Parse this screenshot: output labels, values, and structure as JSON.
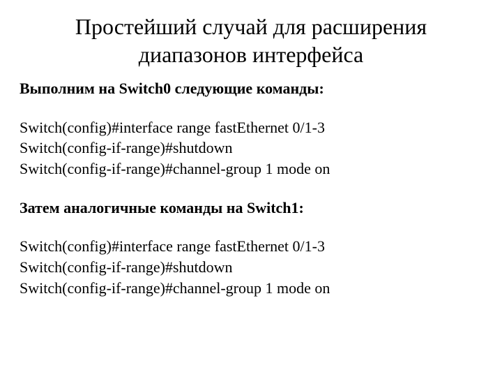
{
  "title_line1": "Простейший случай для расширения",
  "title_line2": "диапазонов интерфейса",
  "section1_heading": "Выполним на Switch0 следующие команды:",
  "section1_cmds": [
    "Switch(config)#interface range fastEthernet 0/1-3",
    "Switch(config-if-range)#shutdown",
    "Switch(config-if-range)#channel-group 1 mode on"
  ],
  "section2_heading": "Затем  аналогичные команды на Switch1:",
  "section2_cmds": [
    "Switch(config)#interface range fastEthernet 0/1-3",
    "Switch(config-if-range)#shutdown",
    "Switch(config-if-range)#channel-group 1 mode on"
  ]
}
